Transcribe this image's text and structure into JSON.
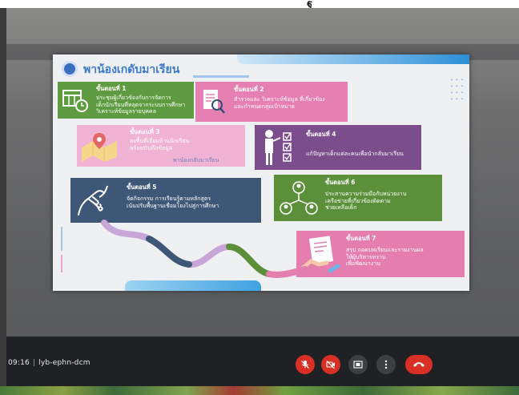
{
  "photo": {
    "top_glyph": "ฐ"
  },
  "slide": {
    "title": "พาน้องเกดับมาเรียน",
    "cards": [
      {
        "head": "ขั้นตอนที่ 1",
        "lines": [
          "ประชุมผู้เกี่ยวข้องกับการจัดการ",
          "เด็กนักเรียนที่หลุดจากระบบการศึกษา",
          "วิเคราะห์ข้อมูลรายบุคคล"
        ]
      },
      {
        "head": "ขั้นตอนที่ 2",
        "lines": [
          "สำรวจและ วิเคราะห์ข้อมูล ที่เกี่ยวข้อง",
          "และกำหนดกลุ่มเป้าหมาย"
        ]
      },
      {
        "head": "ขั้นตอนที่ 3",
        "lines": [
          "ลงพื้นที่เยี่ยมบ้านนักเรียน",
          "พร้อมบันทึกข้อมูล",
          "พาน้องกลับมาเรียน"
        ]
      },
      {
        "head": "ขั้นตอนที่ 4",
        "lines": [
          "แก้ปัญหาเด็กแต่ละคนเพื่อนำกลับมาเรียน"
        ]
      },
      {
        "head": "ขั้นตอนที่ 5",
        "lines": [
          "จัดกิจกรรม การเรียนรู้ตามหลักสูตร",
          "เน้นปรับพื้นฐานเชื่อมโยงไปสู่การศึกษา"
        ]
      },
      {
        "head": "ขั้นตอนที่ 6",
        "lines": [
          "ประสานความร่วมมือกับหน่วยงาน",
          "เครือข่ายที่เกี่ยวข้องติดตาม",
          "ช่วยเหลือเด็ก"
        ]
      },
      {
        "head": "ขั้นตอนที่ 7",
        "lines": [
          "สรุป ถอดบทเรียนและรายงานผล",
          "ให้ผู้บริหารทราบ",
          "เพื่อพัฒนางาน"
        ]
      }
    ],
    "icons": [
      "calendar-clock-icon",
      "document-search-icon",
      "map-pin-icon",
      "checklist-person-icon",
      "handshake-icon",
      "people-network-icon",
      "document-hand-icon"
    ]
  },
  "meeting": {
    "time": "09:16",
    "separator": "|",
    "code": "lyb-ephn-dcm"
  },
  "controls": [
    "mic-off-icon",
    "camera-off-icon",
    "present-icon",
    "more-options-icon",
    "end-call-icon"
  ],
  "colors": {
    "end_call": "#d93025",
    "control_gray": "#3c4043"
  }
}
